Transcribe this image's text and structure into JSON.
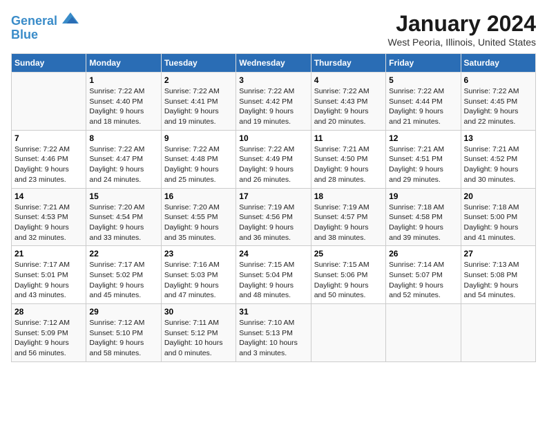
{
  "header": {
    "logo_line1": "General",
    "logo_line2": "Blue",
    "month": "January 2024",
    "location": "West Peoria, Illinois, United States"
  },
  "days_of_week": [
    "Sunday",
    "Monday",
    "Tuesday",
    "Wednesday",
    "Thursday",
    "Friday",
    "Saturday"
  ],
  "weeks": [
    [
      {
        "day": "",
        "info": ""
      },
      {
        "day": "1",
        "info": "Sunrise: 7:22 AM\nSunset: 4:40 PM\nDaylight: 9 hours\nand 18 minutes."
      },
      {
        "day": "2",
        "info": "Sunrise: 7:22 AM\nSunset: 4:41 PM\nDaylight: 9 hours\nand 19 minutes."
      },
      {
        "day": "3",
        "info": "Sunrise: 7:22 AM\nSunset: 4:42 PM\nDaylight: 9 hours\nand 19 minutes."
      },
      {
        "day": "4",
        "info": "Sunrise: 7:22 AM\nSunset: 4:43 PM\nDaylight: 9 hours\nand 20 minutes."
      },
      {
        "day": "5",
        "info": "Sunrise: 7:22 AM\nSunset: 4:44 PM\nDaylight: 9 hours\nand 21 minutes."
      },
      {
        "day": "6",
        "info": "Sunrise: 7:22 AM\nSunset: 4:45 PM\nDaylight: 9 hours\nand 22 minutes."
      }
    ],
    [
      {
        "day": "7",
        "info": "Sunrise: 7:22 AM\nSunset: 4:46 PM\nDaylight: 9 hours\nand 23 minutes."
      },
      {
        "day": "8",
        "info": "Sunrise: 7:22 AM\nSunset: 4:47 PM\nDaylight: 9 hours\nand 24 minutes."
      },
      {
        "day": "9",
        "info": "Sunrise: 7:22 AM\nSunset: 4:48 PM\nDaylight: 9 hours\nand 25 minutes."
      },
      {
        "day": "10",
        "info": "Sunrise: 7:22 AM\nSunset: 4:49 PM\nDaylight: 9 hours\nand 26 minutes."
      },
      {
        "day": "11",
        "info": "Sunrise: 7:21 AM\nSunset: 4:50 PM\nDaylight: 9 hours\nand 28 minutes."
      },
      {
        "day": "12",
        "info": "Sunrise: 7:21 AM\nSunset: 4:51 PM\nDaylight: 9 hours\nand 29 minutes."
      },
      {
        "day": "13",
        "info": "Sunrise: 7:21 AM\nSunset: 4:52 PM\nDaylight: 9 hours\nand 30 minutes."
      }
    ],
    [
      {
        "day": "14",
        "info": "Sunrise: 7:21 AM\nSunset: 4:53 PM\nDaylight: 9 hours\nand 32 minutes."
      },
      {
        "day": "15",
        "info": "Sunrise: 7:20 AM\nSunset: 4:54 PM\nDaylight: 9 hours\nand 33 minutes."
      },
      {
        "day": "16",
        "info": "Sunrise: 7:20 AM\nSunset: 4:55 PM\nDaylight: 9 hours\nand 35 minutes."
      },
      {
        "day": "17",
        "info": "Sunrise: 7:19 AM\nSunset: 4:56 PM\nDaylight: 9 hours\nand 36 minutes."
      },
      {
        "day": "18",
        "info": "Sunrise: 7:19 AM\nSunset: 4:57 PM\nDaylight: 9 hours\nand 38 minutes."
      },
      {
        "day": "19",
        "info": "Sunrise: 7:18 AM\nSunset: 4:58 PM\nDaylight: 9 hours\nand 39 minutes."
      },
      {
        "day": "20",
        "info": "Sunrise: 7:18 AM\nSunset: 5:00 PM\nDaylight: 9 hours\nand 41 minutes."
      }
    ],
    [
      {
        "day": "21",
        "info": "Sunrise: 7:17 AM\nSunset: 5:01 PM\nDaylight: 9 hours\nand 43 minutes."
      },
      {
        "day": "22",
        "info": "Sunrise: 7:17 AM\nSunset: 5:02 PM\nDaylight: 9 hours\nand 45 minutes."
      },
      {
        "day": "23",
        "info": "Sunrise: 7:16 AM\nSunset: 5:03 PM\nDaylight: 9 hours\nand 47 minutes."
      },
      {
        "day": "24",
        "info": "Sunrise: 7:15 AM\nSunset: 5:04 PM\nDaylight: 9 hours\nand 48 minutes."
      },
      {
        "day": "25",
        "info": "Sunrise: 7:15 AM\nSunset: 5:06 PM\nDaylight: 9 hours\nand 50 minutes."
      },
      {
        "day": "26",
        "info": "Sunrise: 7:14 AM\nSunset: 5:07 PM\nDaylight: 9 hours\nand 52 minutes."
      },
      {
        "day": "27",
        "info": "Sunrise: 7:13 AM\nSunset: 5:08 PM\nDaylight: 9 hours\nand 54 minutes."
      }
    ],
    [
      {
        "day": "28",
        "info": "Sunrise: 7:12 AM\nSunset: 5:09 PM\nDaylight: 9 hours\nand 56 minutes."
      },
      {
        "day": "29",
        "info": "Sunrise: 7:12 AM\nSunset: 5:10 PM\nDaylight: 9 hours\nand 58 minutes."
      },
      {
        "day": "30",
        "info": "Sunrise: 7:11 AM\nSunset: 5:12 PM\nDaylight: 10 hours\nand 0 minutes."
      },
      {
        "day": "31",
        "info": "Sunrise: 7:10 AM\nSunset: 5:13 PM\nDaylight: 10 hours\nand 3 minutes."
      },
      {
        "day": "",
        "info": ""
      },
      {
        "day": "",
        "info": ""
      },
      {
        "day": "",
        "info": ""
      }
    ]
  ]
}
